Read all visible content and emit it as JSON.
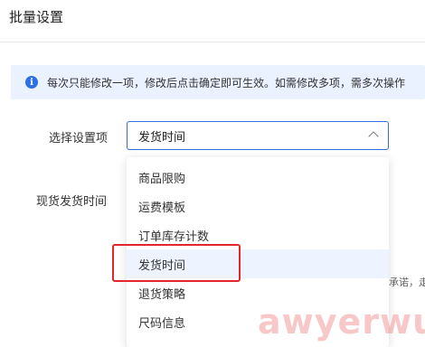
{
  "dialog": {
    "title": "批量设置"
  },
  "notice": {
    "icon": "info-icon",
    "text": "每次只能修改一项，修改后点击确定即可生效。如需修改多项，需多次操作"
  },
  "form": {
    "select_label": "选择设置项",
    "selected_value": "发货时间",
    "ship_label": "现货发货时间",
    "partial_text": "承诺，走"
  },
  "dropdown": {
    "options": [
      "商品限购",
      "运费模板",
      "订单库存计数",
      "发货时间",
      "退货策略",
      "尺码信息"
    ],
    "selected_index": 3
  },
  "watermark": "awyerwu.com",
  "colors": {
    "accent": "#2f6fe4",
    "notice_bg": "#eaf2ff",
    "selected_option_bg": "#eef4ff",
    "annotation_red": "#e3262b"
  }
}
